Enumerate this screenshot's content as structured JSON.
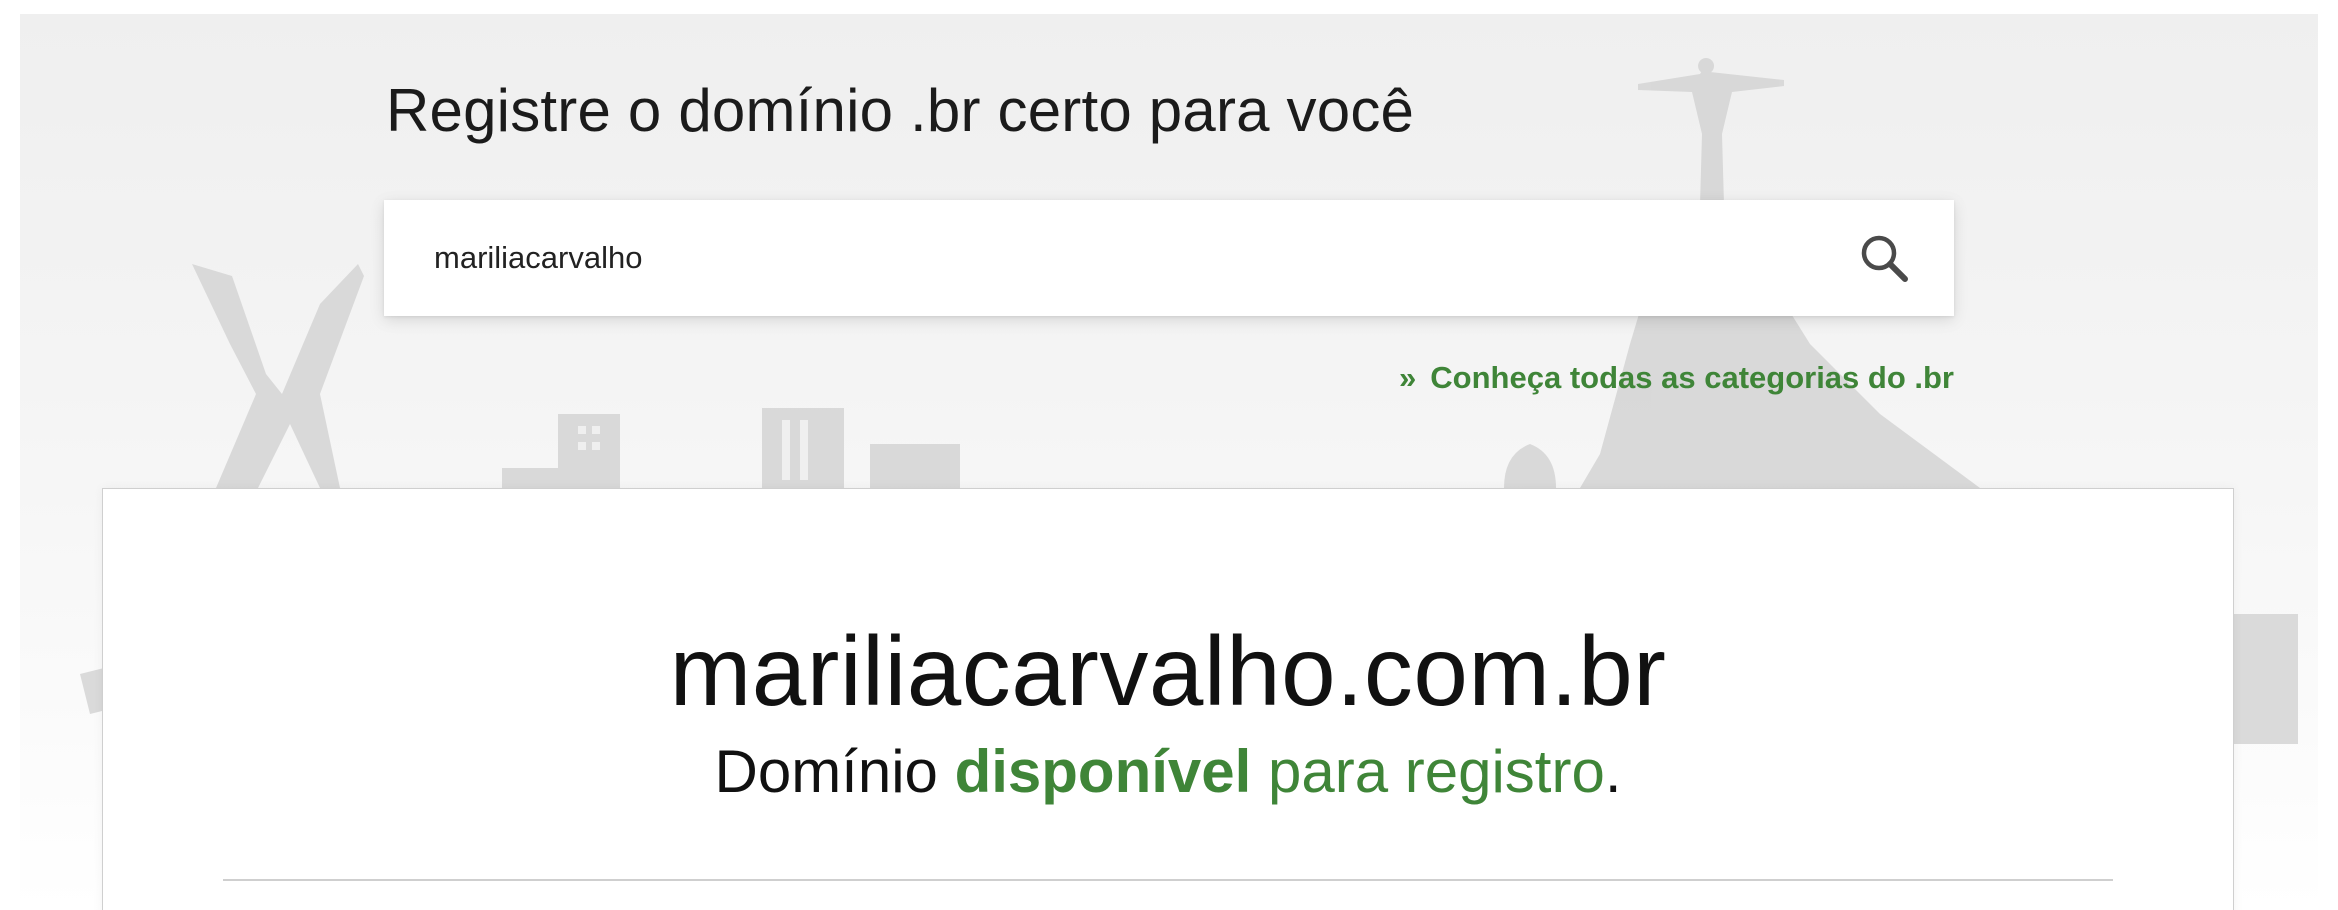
{
  "header": {
    "title": "Registre o domínio .br certo para você"
  },
  "search": {
    "value": "mariliacarvalho",
    "button_icon": "search-icon"
  },
  "categories_link": {
    "prefix": "»",
    "label": "Conheça todas as categorias do .br"
  },
  "result": {
    "domain": "mariliacarvalho.com.br",
    "message_prefix": "Domínio",
    "status": "disponível",
    "message_suffix": "para registro",
    "message_end": "."
  },
  "colors": {
    "accent_green": "#3f8538",
    "background": "#efefef",
    "text": "#111111"
  }
}
